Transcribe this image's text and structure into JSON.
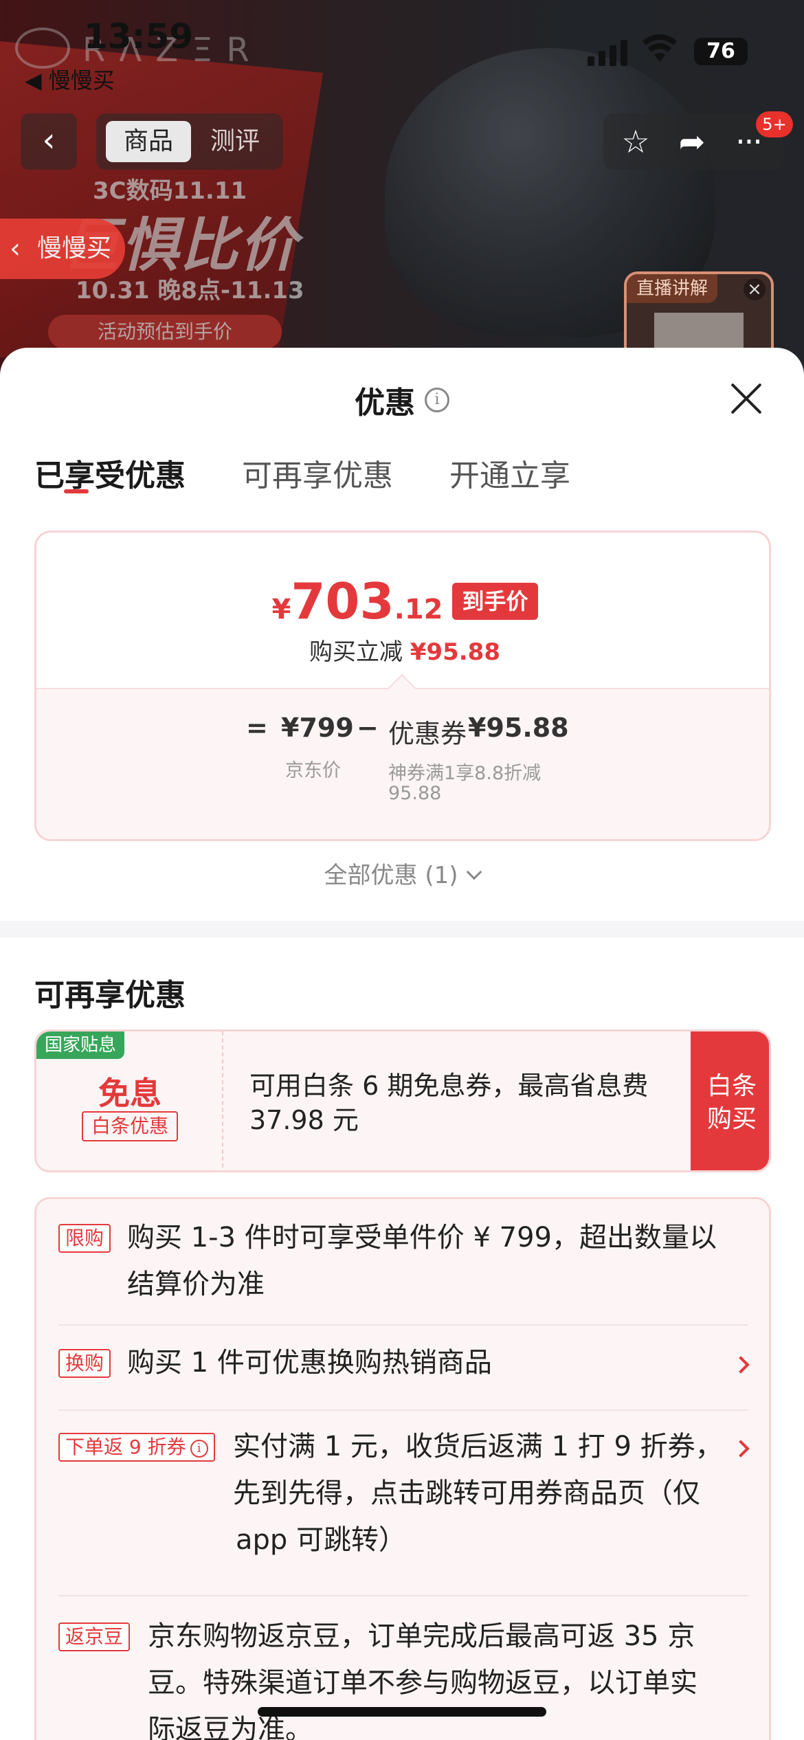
{
  "status_bar": {
    "time": "13:59",
    "back_app": "◀ 慢慢买",
    "battery": "76"
  },
  "background": {
    "brand_logo": "RΛZΞR",
    "promo_line1": "3C数码11.11",
    "promo_line2": "巨惧比价",
    "promo_line3": "10.31 晚8点-11.13",
    "promo_line4": "活动预估到手价",
    "nav_tabs": [
      "商品",
      "测评"
    ],
    "notification_badge": "5+",
    "slowbuy_label": "慢慢买",
    "live_label": "直播讲解"
  },
  "sheet": {
    "title": "优惠",
    "tabs": [
      "已享受优惠",
      "可再享优惠",
      "开通立享"
    ],
    "price_card": {
      "currency": "¥",
      "price_int": "703",
      "price_dec": ".12",
      "badge": "到手价",
      "sub_label": "购买立减",
      "sub_amount": "¥95.88",
      "eq": "=",
      "jd_price": "¥799",
      "jd_price_label": "京东价",
      "minus": "−",
      "coupon_label": "优惠券",
      "coupon_amount": "¥95.88",
      "coupon_note_line1": "神券满1享8.8折减",
      "coupon_note_line2": "95.88"
    },
    "all_discounts": "全部优惠 (1)",
    "more_section_title": "可再享优惠",
    "baitiao": {
      "gov_tag": "国家贴息",
      "big": "免息",
      "tag": "白条优惠",
      "text": "可用白条 6 期免息券，最高省息费 37.98 元",
      "button_line1": "白条",
      "button_line2": "购买"
    },
    "rules": [
      {
        "tag": "限购",
        "text_line1": "购买 1-3 件时可享受单件价 ¥ 799，超出数量以",
        "text_line2": "结算价为准"
      },
      {
        "tag": "换购",
        "text_line1": "购买 1 件可优惠换购热销商品"
      },
      {
        "tag": "下单返 9 折券",
        "text_line1": "实付满 1 元，收货后返满 1 打 9 折券，",
        "text_line2": "先到先得，点击跳转可用券商品页（仅",
        "text_line3": "app 可跳转）"
      },
      {
        "tag": "返京豆",
        "text_line1": "京东购物返京豆，订单完成后最高可返 35 京",
        "text_line2": "豆。特殊渠道订单不参与购物返豆，以订单实",
        "text_line3": "际返豆为准。"
      }
    ]
  },
  "colors": {
    "accent_red": "#e4393c",
    "gov_green": "#37a65a",
    "card_bg": "#fdf5f5"
  }
}
